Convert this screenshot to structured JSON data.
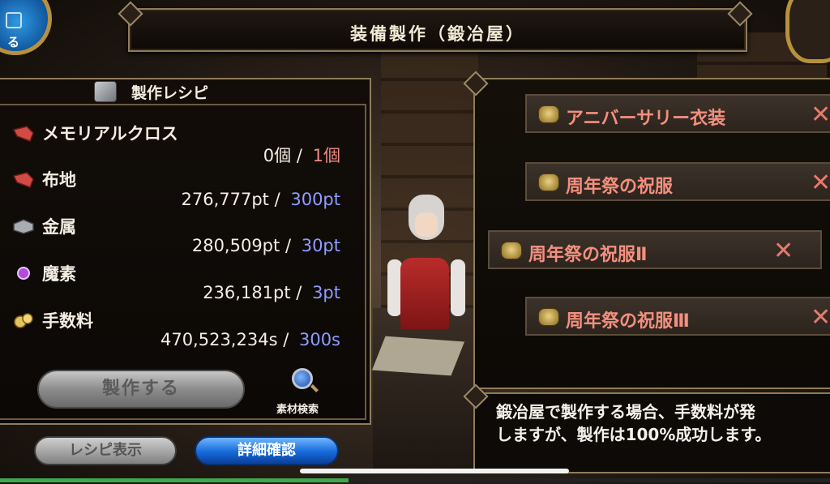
{
  "header": {
    "title": "装備製作（鍛冶屋）",
    "back_label": "る"
  },
  "recipe": {
    "title": "製作レシピ",
    "product": "メモリアルクロス",
    "product_have": "0個",
    "product_need": "1個",
    "materials": [
      {
        "name": "布地",
        "icon": "cloth-icon",
        "have": "276,777pt",
        "need": "300pt"
      },
      {
        "name": "金属",
        "icon": "metal-icon",
        "have": "280,509pt",
        "need": "30pt"
      },
      {
        "name": "魔素",
        "icon": "magic-orb-icon",
        "have": "236,181pt",
        "need": "3pt"
      },
      {
        "name": "手数料",
        "icon": "coins-icon",
        "have": "470,523,234s",
        "need": "300s"
      }
    ],
    "separator": "/",
    "make_label": "製作する",
    "search_label": "素材検索"
  },
  "buttons": {
    "recipe_view": "レシピ表示",
    "detail": "詳細確認"
  },
  "list": {
    "items": [
      {
        "label": "アニバーサリー衣装",
        "selected": false
      },
      {
        "label": "周年祭の祝服",
        "selected": false
      },
      {
        "label": "周年祭の祝服Ⅱ",
        "selected": true
      },
      {
        "label": "周年祭の祝服Ⅲ",
        "selected": false
      }
    ],
    "close_glyph": "✕"
  },
  "message": {
    "line1": "鍛冶屋で製作する場合、手数料が発",
    "line2": "しますが、製作は100%成功します。"
  },
  "colors": {
    "accent_red": "#f48f7e",
    "accent_blue": "#8f9dff",
    "frame_gold": "#8f7c5a"
  },
  "status": {
    "progress_pct": 42
  }
}
